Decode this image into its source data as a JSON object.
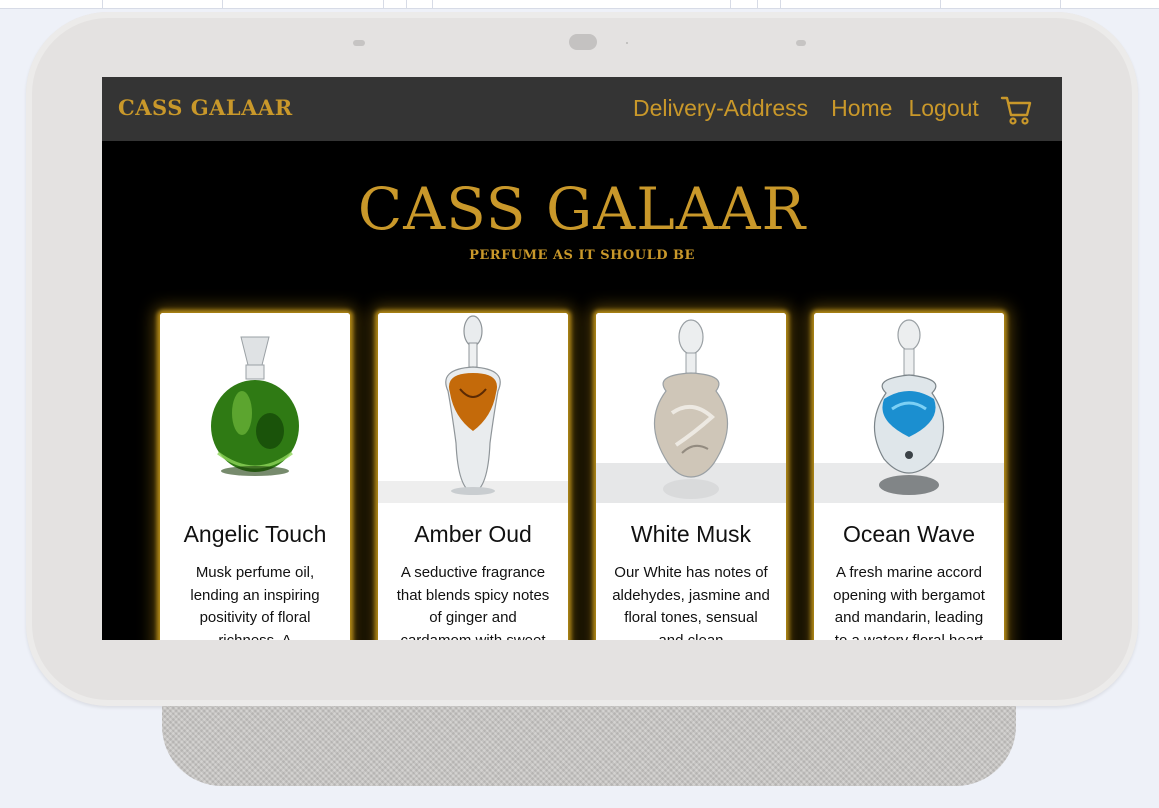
{
  "navbar": {
    "brand": "CASS GALAAR",
    "links": [
      "Delivery-Address",
      "Home",
      "Logout"
    ],
    "cart_icon": "shopping-cart-icon"
  },
  "hero": {
    "title": "CASS GALAAR",
    "subtitle": "PERFUME AS IT SHOULD BE"
  },
  "products": [
    {
      "name": "Angelic Touch",
      "description": "Musk perfume oil, lending an inspiring positivity of floral richness. A",
      "bottle_color": "#2f7a14"
    },
    {
      "name": "Amber Oud",
      "description": "A seductive fragrance that blends spicy notes of ginger and cardamom with sweet",
      "bottle_color": "#c46a0a"
    },
    {
      "name": "White Musk",
      "description": "Our White has notes of aldehydes, jasmine and floral tones, sensual and clean",
      "bottle_color": "#cfc6b8"
    },
    {
      "name": "Ocean Wave",
      "description": "A fresh marine accord opening with bergamot and mandarin, leading to a watery floral heart",
      "bottle_color": "#1b8fd0"
    }
  ],
  "colors": {
    "gold": "#c9982a",
    "navbar_bg": "#343434",
    "screen_bg": "#000000"
  }
}
